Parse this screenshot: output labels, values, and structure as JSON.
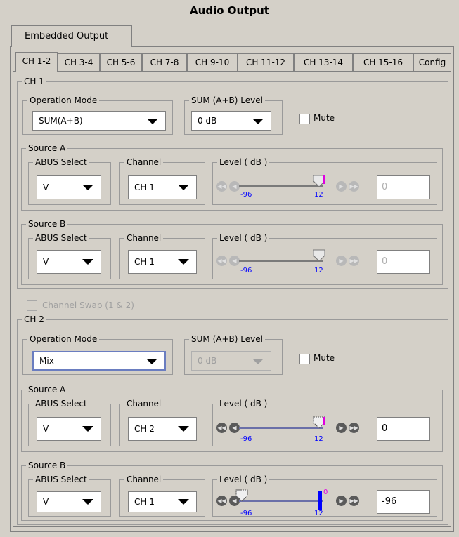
{
  "title": "Audio Output",
  "outer_tab": "Embedded Output",
  "tabs": [
    "CH 1-2",
    "CH 3-4",
    "CH 5-6",
    "CH 7-8",
    "CH 9-10",
    "CH 11-12",
    "CH 13-14",
    "CH 15-16",
    "Config"
  ],
  "ch1": {
    "legend": "CH 1",
    "operation_mode_label": "Operation Mode",
    "operation_mode": "SUM(A+B)",
    "sum_label": "SUM (A+B) Level",
    "sum_level": "0 dB",
    "mute_label": "Mute",
    "source_a": {
      "legend": "Source A",
      "abus_label": "ABUS Select",
      "abus": "V",
      "channel_label": "Channel",
      "channel": "CH 1",
      "level_label": "Level ( dB )",
      "min": "-96",
      "max": "12",
      "value": "0",
      "level_value": 0
    },
    "source_b": {
      "legend": "Source B",
      "abus_label": "ABUS Select",
      "abus": "V",
      "channel_label": "Channel",
      "channel": "CH 1",
      "level_label": "Level ( dB )",
      "min": "-96",
      "max": "12",
      "value": "0",
      "level_value": 0
    }
  },
  "channel_swap": "Channel Swap (1 & 2)",
  "ch2": {
    "legend": "CH 2",
    "operation_mode_label": "Operation Mode",
    "operation_mode": "Mix",
    "sum_label": "SUM (A+B) Level",
    "sum_level": "0 dB",
    "mute_label": "Mute",
    "source_a": {
      "legend": "Source A",
      "abus_label": "ABUS Select",
      "abus": "V",
      "channel_label": "Channel",
      "channel": "CH 2",
      "level_label": "Level ( dB )",
      "min": "-96",
      "max": "12",
      "value": "0",
      "level_value": 0
    },
    "source_b": {
      "legend": "Source B",
      "abus_label": "ABUS Select",
      "abus": "V",
      "channel_label": "Channel",
      "channel": "CH 1",
      "level_label": "Level ( dB )",
      "min": "-96",
      "max": "12",
      "marker_label": "0",
      "value": "-96",
      "level_value": -96
    }
  },
  "colors": {
    "active_track": "#6a6fa8",
    "tick_label": "#0000ff",
    "marker_magenta": "#e000e0",
    "marker_blue": "#0000ff"
  }
}
